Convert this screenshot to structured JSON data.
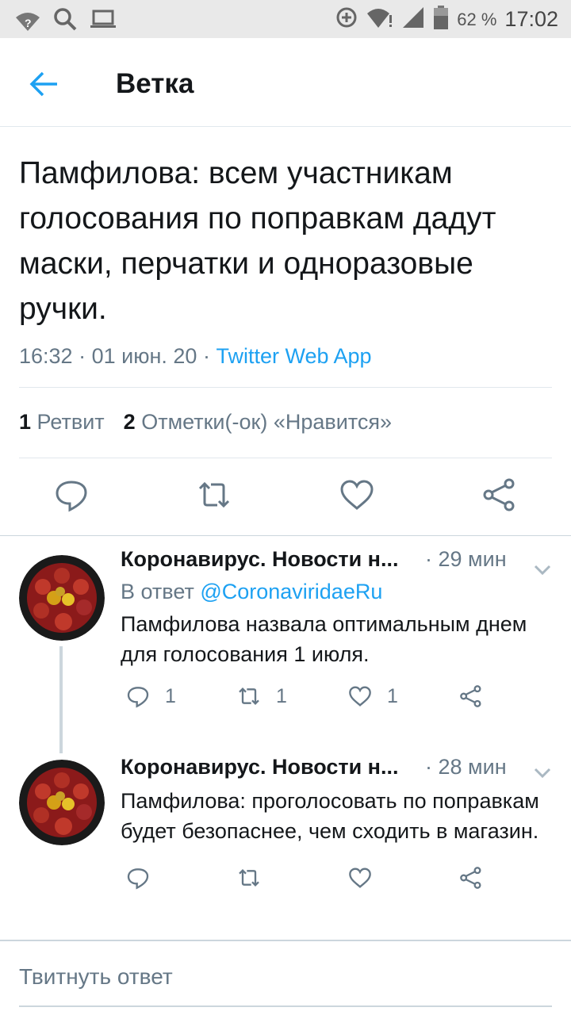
{
  "status_bar": {
    "battery_percent": "62 %",
    "time": "17:02",
    "wifi_label": "?"
  },
  "header": {
    "title": "Ветка"
  },
  "main_tweet": {
    "text": "Памфилова: всем участникам голосования по поправкам дадут маски, перчатки и одноразовые ручки.",
    "time": "16:32",
    "date": "01 июн. 20",
    "separator": "·",
    "source": "Twitter Web App",
    "retweets_count": "1",
    "retweets_label": "Ретвит",
    "likes_count": "2",
    "likes_label": "Отметки(-ок) «Нравится»"
  },
  "replies": [
    {
      "author": "Коронавирус. Новости н...",
      "time": "29 мин",
      "separator": "·",
      "reply_to_prefix": "В ответ",
      "reply_to_handle": "@CoronaviridaeRu",
      "text": "Памфилова назвала оптимальным днем для голосования 1 июля.",
      "reply_count": "1",
      "retweet_count": "1",
      "like_count": "1"
    },
    {
      "author": "Коронавирус. Новости н...",
      "time": "28 мин",
      "separator": "·",
      "text": "Памфилова: проголосовать по поправкам будет безопаснее, чем сходить в магазин."
    }
  ],
  "compose": {
    "placeholder": "Твитнуть ответ"
  },
  "colors": {
    "accent": "#1da1f2",
    "muted": "#657786",
    "text": "#14171a"
  }
}
